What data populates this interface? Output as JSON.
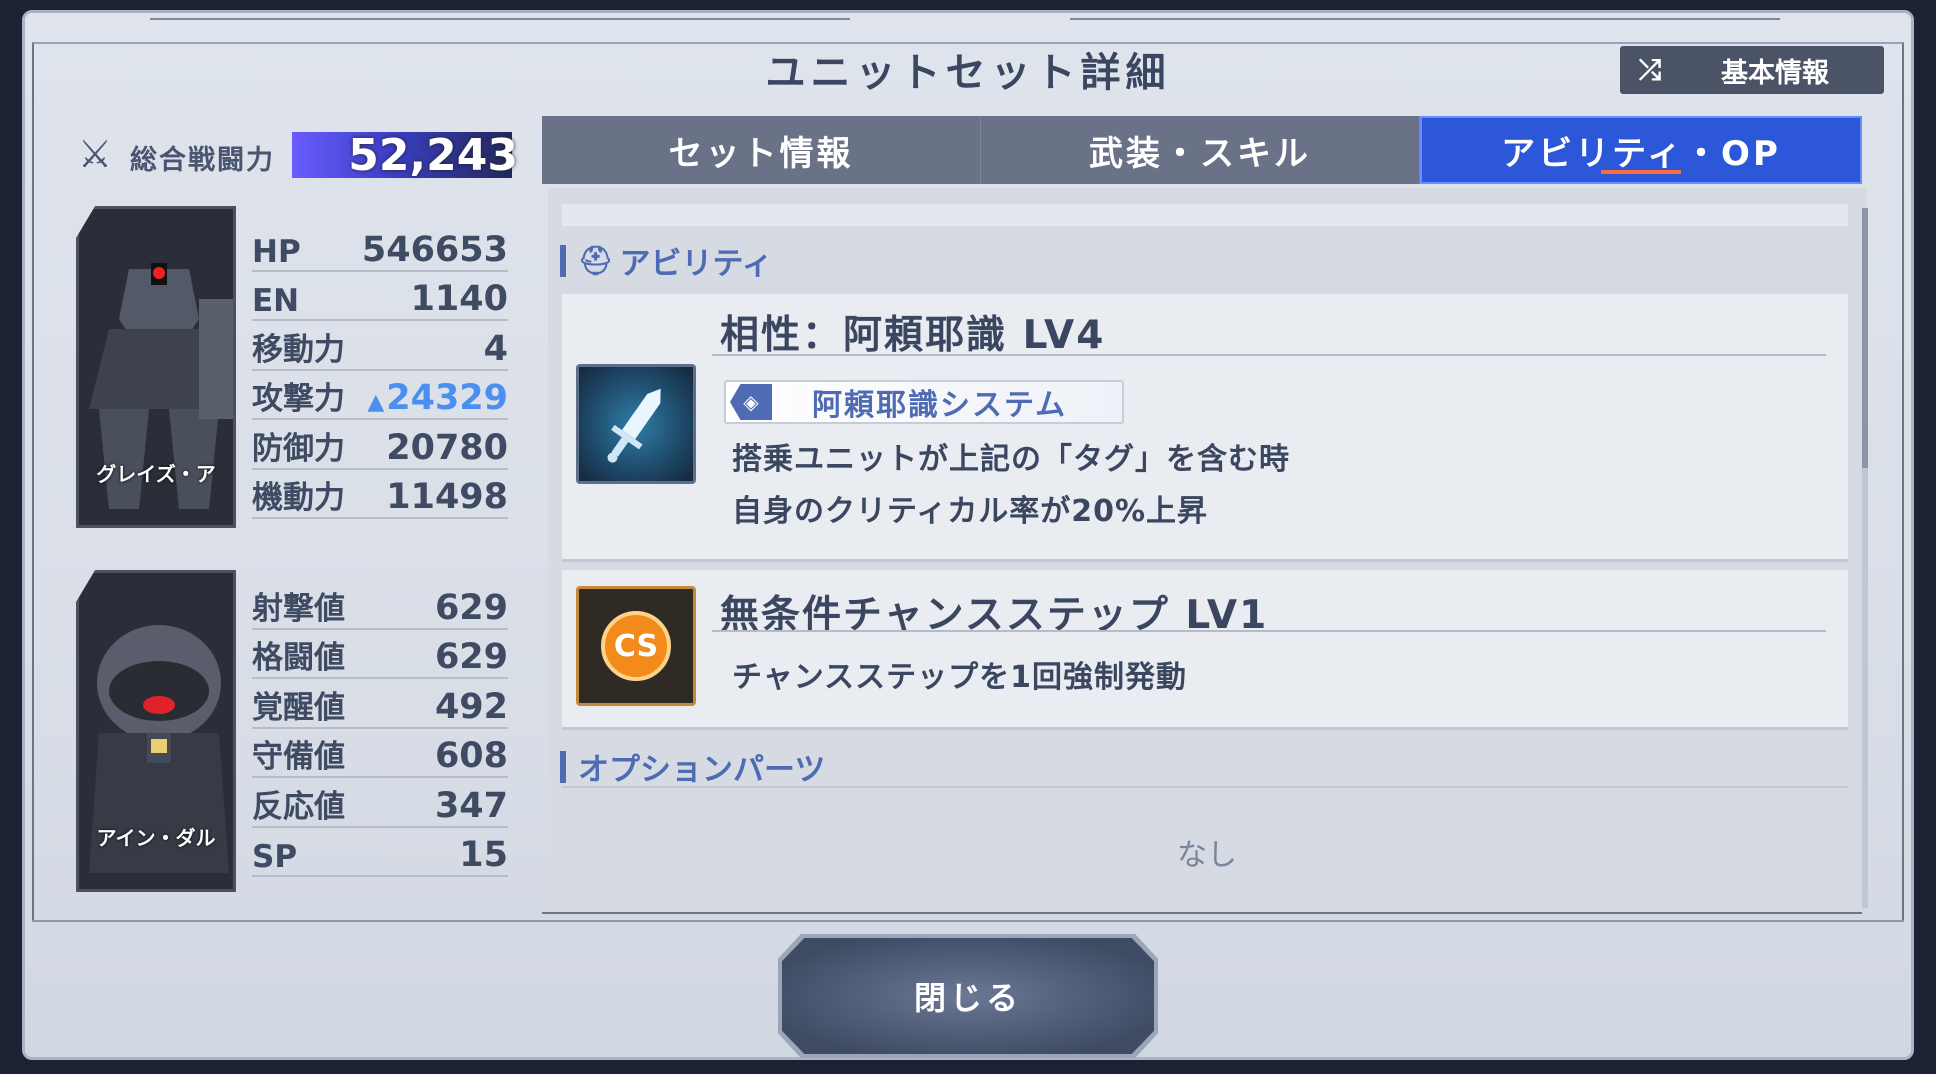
{
  "title": "ユニットセット詳細",
  "basic_button": {
    "icon": "shuffle-icon",
    "label": "基本情報"
  },
  "combat_power": {
    "label": "総合戦闘力",
    "value": "52,243"
  },
  "unit1": {
    "name": "グレイズ・ア",
    "stats": [
      {
        "key": "HP",
        "value": "546653",
        "boosted": false
      },
      {
        "key": "EN",
        "value": "1140",
        "boosted": false
      },
      {
        "key": "移動力",
        "value": "4",
        "boosted": false
      },
      {
        "key": "攻撃力",
        "value": "24329",
        "boosted": true
      },
      {
        "key": "防御力",
        "value": "20780",
        "boosted": false
      },
      {
        "key": "機動力",
        "value": "11498",
        "boosted": false
      }
    ]
  },
  "pilot": {
    "name": "アイン・ダル",
    "stats": [
      {
        "key": "射撃値",
        "value": "629"
      },
      {
        "key": "格闘値",
        "value": "629"
      },
      {
        "key": "覚醒値",
        "value": "492"
      },
      {
        "key": "守備値",
        "value": "608"
      },
      {
        "key": "反応値",
        "value": "347"
      },
      {
        "key": "SP",
        "value": "15"
      }
    ]
  },
  "tabs": [
    {
      "label": "セット情報",
      "active": false
    },
    {
      "label": "武装・スキル",
      "active": false
    },
    {
      "label": "アビリティ・OP",
      "active": true
    }
  ],
  "ability_section": {
    "label": "アビリティ"
  },
  "abilities": [
    {
      "icon": "sword-icon",
      "title": "相性：阿頼耶識 LV4",
      "tag": "阿頼耶識システム",
      "lines": [
        "搭乗ユニットが上記の「タグ」を含む時",
        "自身のクリティカル率が20%上昇"
      ]
    },
    {
      "icon": "cs-icon",
      "icon_text": "CS",
      "title": "無条件チャンスステップ LV1",
      "lines": [
        "チャンスステップを1回強制発動"
      ]
    }
  ],
  "option_section": {
    "label": "オプションパーツ",
    "empty_text": "なし"
  },
  "close_button": {
    "label": "閉じる"
  },
  "colors": {
    "active_tab": "#2b57d8",
    "accent_text": "#4e6bb3",
    "boost": "#4b8ff0"
  }
}
